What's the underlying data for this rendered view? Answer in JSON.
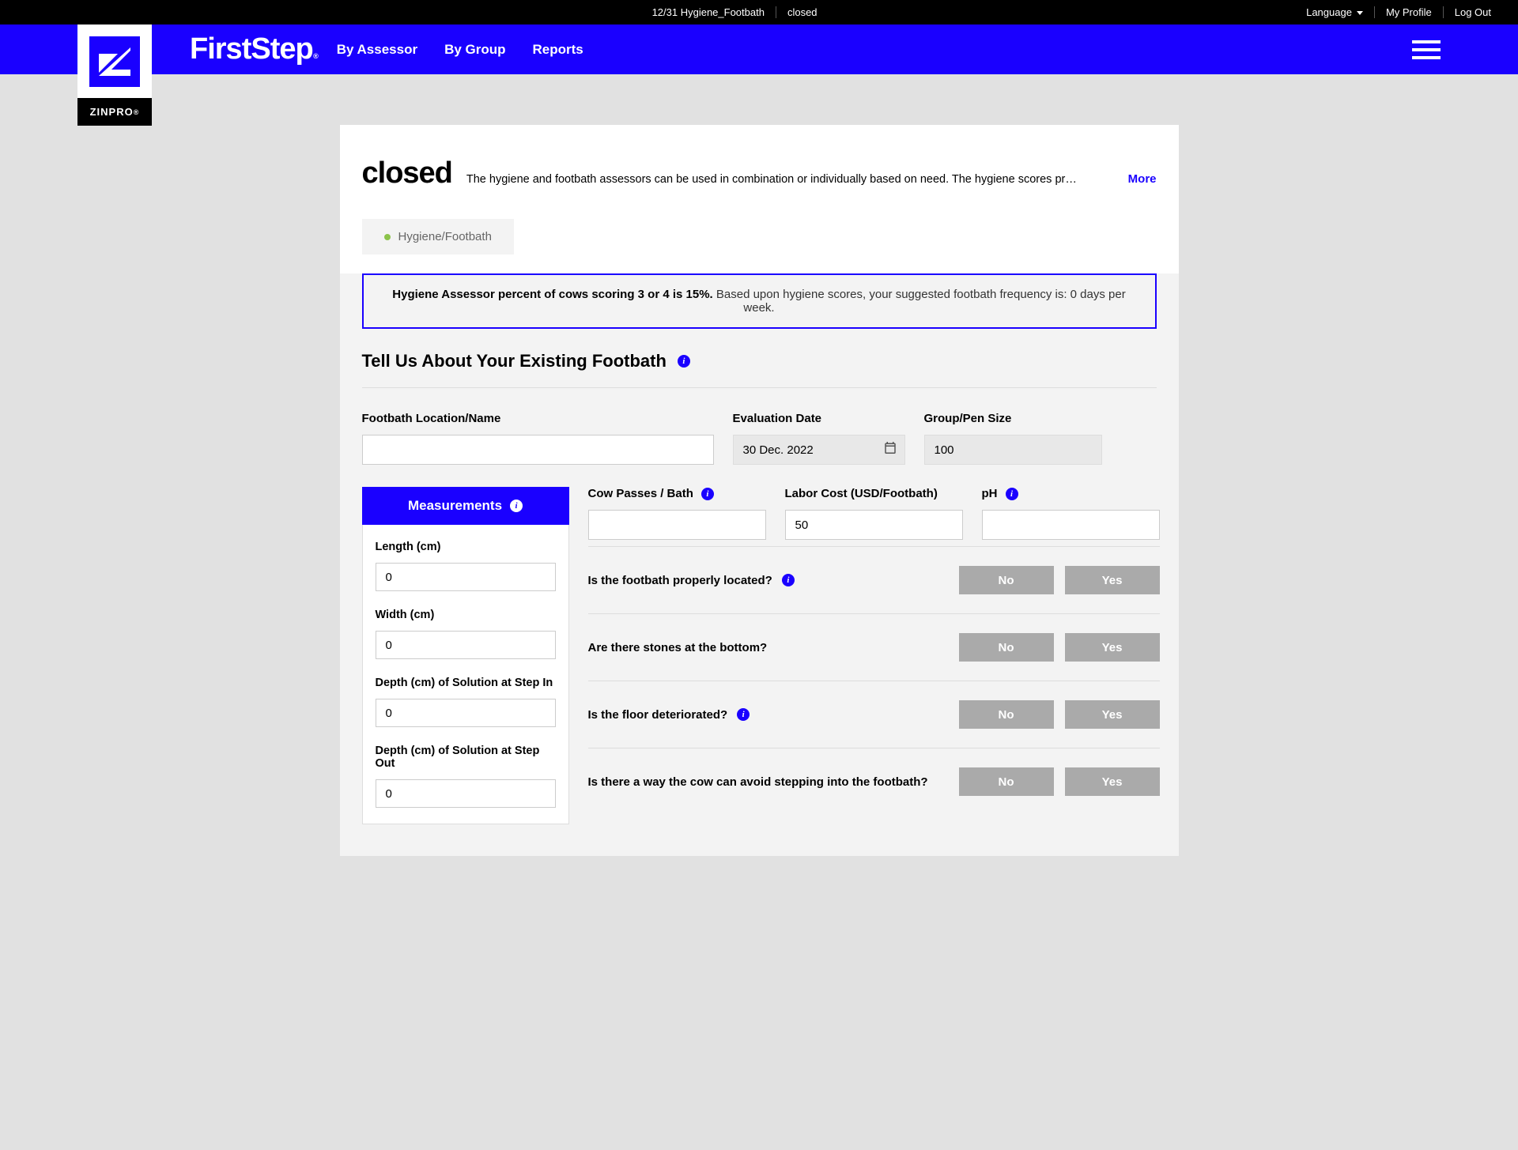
{
  "topbar": {
    "context": "12/31 Hygiene_Footbath",
    "status": "closed",
    "language": "Language",
    "profile": "My Profile",
    "logout": "Log Out"
  },
  "brand": {
    "name": "FirstStep",
    "logo_text": "ZINPRO",
    "reg": "®"
  },
  "nav": {
    "by_assessor": "By Assessor",
    "by_group": "By Group",
    "reports": "Reports"
  },
  "page": {
    "title": "closed",
    "desc": "The hygiene and footbath assessors can be used in combination or individually based on need. The hygiene scores pr…",
    "more": "More"
  },
  "tab": {
    "label": "Hygiene/Footbath"
  },
  "alert": {
    "bold": "Hygiene Assessor percent of cows scoring 3 or 4 is 15%.",
    "rest": " Based upon hygiene scores, your suggested footbath frequency is: 0 days per week."
  },
  "section": {
    "title": "Tell Us About Your Existing Footbath"
  },
  "fields": {
    "location": {
      "label": "Footbath Location/Name",
      "value": ""
    },
    "eval_date": {
      "label": "Evaluation Date",
      "value": "30 Dec. 2022"
    },
    "group_size": {
      "label": "Group/Pen Size",
      "value": "100"
    },
    "cow_passes": {
      "label": "Cow Passes / Bath",
      "value": ""
    },
    "labor_cost": {
      "label": "Labor Cost (USD/Footbath)",
      "value": "50"
    },
    "ph": {
      "label": "pH",
      "value": ""
    }
  },
  "measurements": {
    "header": "Measurements",
    "length": {
      "label": "Length (cm)",
      "value": "0"
    },
    "width": {
      "label": "Width (cm)",
      "value": "0"
    },
    "depth_in": {
      "label": "Depth (cm) of Solution at Step In",
      "value": "0"
    },
    "depth_out": {
      "label": "Depth (cm) of Solution at Step Out",
      "value": "0"
    }
  },
  "questions": {
    "q1": "Is the footbath properly located?",
    "q2": "Are there stones at the bottom?",
    "q3": "Is the floor deteriorated?",
    "q4": "Is there a way the cow can avoid stepping into the footbath?",
    "no": "No",
    "yes": "Yes"
  }
}
